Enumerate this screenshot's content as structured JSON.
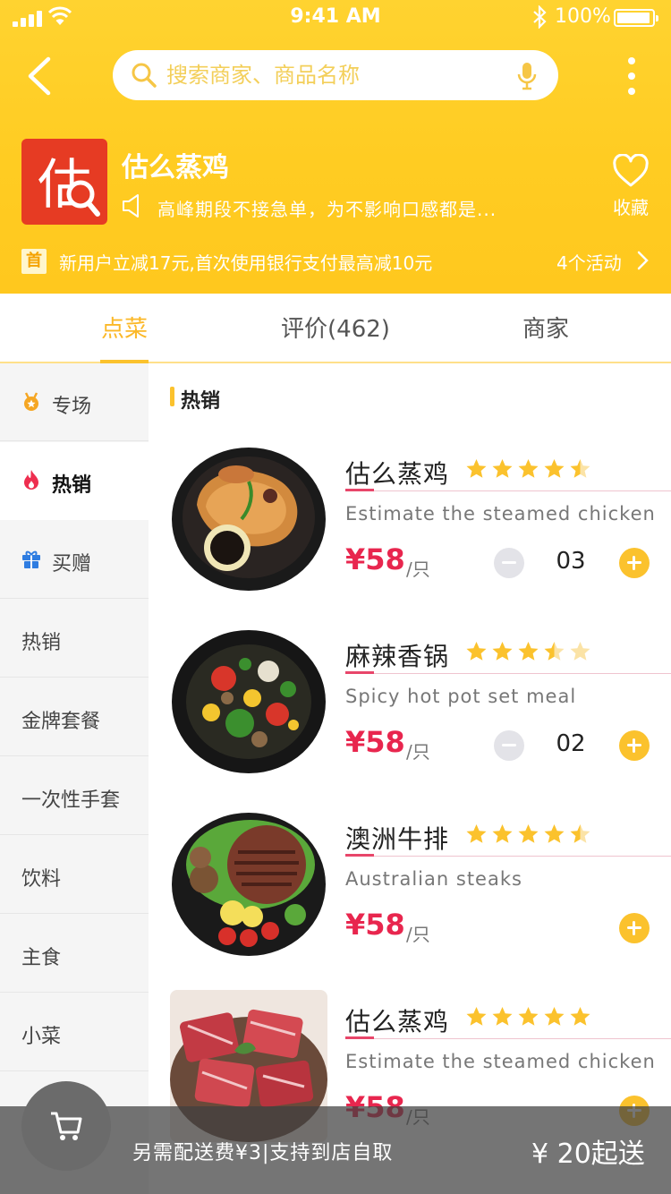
{
  "status_bar": {
    "time": "9:41 AM",
    "battery": "100%"
  },
  "search": {
    "placeholder": "搜索商家、商品名称"
  },
  "shop": {
    "logo_char": "估",
    "name": "估么蒸鸡",
    "notice": "高峰期段不接急单，为不影响口感都是...",
    "favorite_label": "收藏"
  },
  "promo": {
    "tag": "首",
    "text": "新用户立减17元,首次使用银行支付最高减10元",
    "count": "4个活动"
  },
  "tabs": [
    {
      "label": "点菜",
      "active": true
    },
    {
      "label": "评价(462)",
      "active": false
    },
    {
      "label": "商家",
      "active": false
    }
  ],
  "sidebar": {
    "items": [
      {
        "label": "专场",
        "icon": "medal-icon"
      },
      {
        "label": "热销",
        "icon": "fire-icon",
        "active": true
      },
      {
        "label": "买赠",
        "icon": "gift-icon"
      },
      {
        "label": "热销"
      },
      {
        "label": "金牌套餐"
      },
      {
        "label": "一次性手套"
      },
      {
        "label": "饮料"
      },
      {
        "label": "主食"
      },
      {
        "label": "小菜"
      }
    ]
  },
  "section_title": "热销",
  "items": [
    {
      "name": "估么蒸鸡",
      "desc": "Estimate the steamed chicken",
      "price": "¥58",
      "unit": "/只",
      "rating": 4.5,
      "qty": "03",
      "image": "steamed-chicken"
    },
    {
      "name": "麻辣香锅",
      "desc": "Spicy hot pot set meal",
      "price": "¥58",
      "unit": "/只",
      "rating": 3.5,
      "qty": "02",
      "image": "hot-pot"
    },
    {
      "name": "澳洲牛排",
      "desc": "Australian steaks",
      "price": "¥58",
      "unit": "/只",
      "rating": 4.5,
      "qty": null,
      "image": "steak"
    },
    {
      "name": "估么蒸鸡",
      "desc": "Estimate the steamed chicken",
      "price": "¥58",
      "unit": "/只",
      "rating": 5,
      "qty": null,
      "image": "beef-slices"
    }
  ],
  "cart": {
    "delivery_text": "另需配送费¥3|支持到店自取",
    "min_order": "¥ 20起送"
  },
  "colors": {
    "brand_yellow": "#ffcc22",
    "price_red": "#e8264e",
    "star": "#fbc22d"
  }
}
